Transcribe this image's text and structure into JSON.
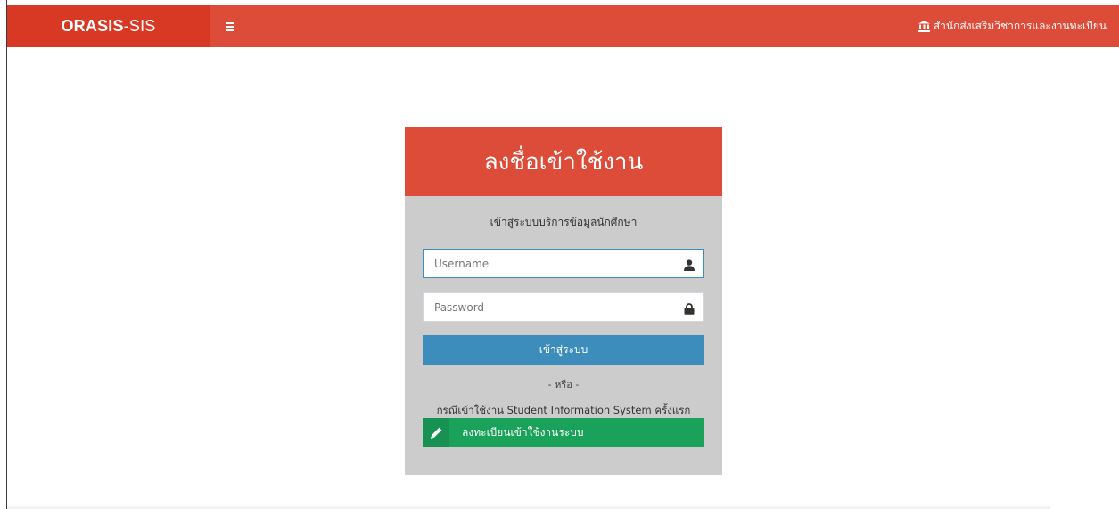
{
  "header": {
    "brand_bold": "ORASIS",
    "brand_light": "-SIS",
    "menu_icon": "hamburger-icon",
    "org_icon": "university-icon",
    "org_name": "สำนักส่งเสริมวิชาการและงานทะเบียน"
  },
  "login": {
    "title": "ลงชื่อเข้าใช้งาน",
    "subtitle": "เข้าสู่ระบบบริการข้อมูลนักศึกษา",
    "username_placeholder": "Username",
    "username_icon": "user-icon",
    "password_placeholder": "Password",
    "password_icon": "lock-icon",
    "login_button": "เข้าสู่ระบบ",
    "or_text": "- หรือ -",
    "first_time_text": "กรณีเข้าใช้งาน Student Information System ครั้งแรก",
    "register_icon": "pencil-icon",
    "register_button": "ลงทะเบียนเข้าใช้งานระบบ"
  },
  "colors": {
    "header_red": "#dd4b39",
    "brand_red": "#d73925",
    "panel_gray": "#cccccc",
    "login_blue": "#3c8dbc",
    "register_green": "#1aa15a"
  }
}
